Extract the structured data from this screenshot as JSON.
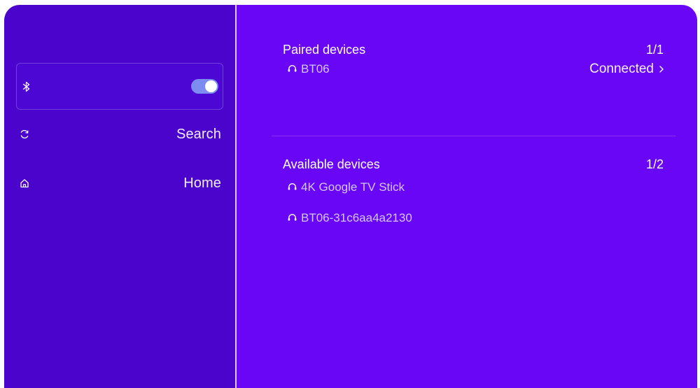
{
  "sidebar": {
    "bluetooth": {
      "icon": "bluetooth-icon",
      "toggle_on": true
    },
    "search": {
      "icon": "refresh-icon",
      "label": "Search"
    },
    "home": {
      "icon": "home-icon",
      "label": "Home"
    }
  },
  "paired": {
    "title": "Paired devices",
    "count": "1/1",
    "devices": [
      {
        "name": "BT06",
        "status": "Connected",
        "icon": "headphones-icon"
      }
    ]
  },
  "available": {
    "title": "Available devices",
    "count": "1/2",
    "devices": [
      {
        "name": "4K Google TV Stick",
        "icon": "headphones-icon"
      },
      {
        "name": "BT06-31c6aa4a2130",
        "icon": "headphones-icon"
      }
    ]
  },
  "colors": {
    "sidebar_bg": "#4a04cc",
    "main_bg": "#6a06f6",
    "toggle_on": "#7d8cf0"
  }
}
